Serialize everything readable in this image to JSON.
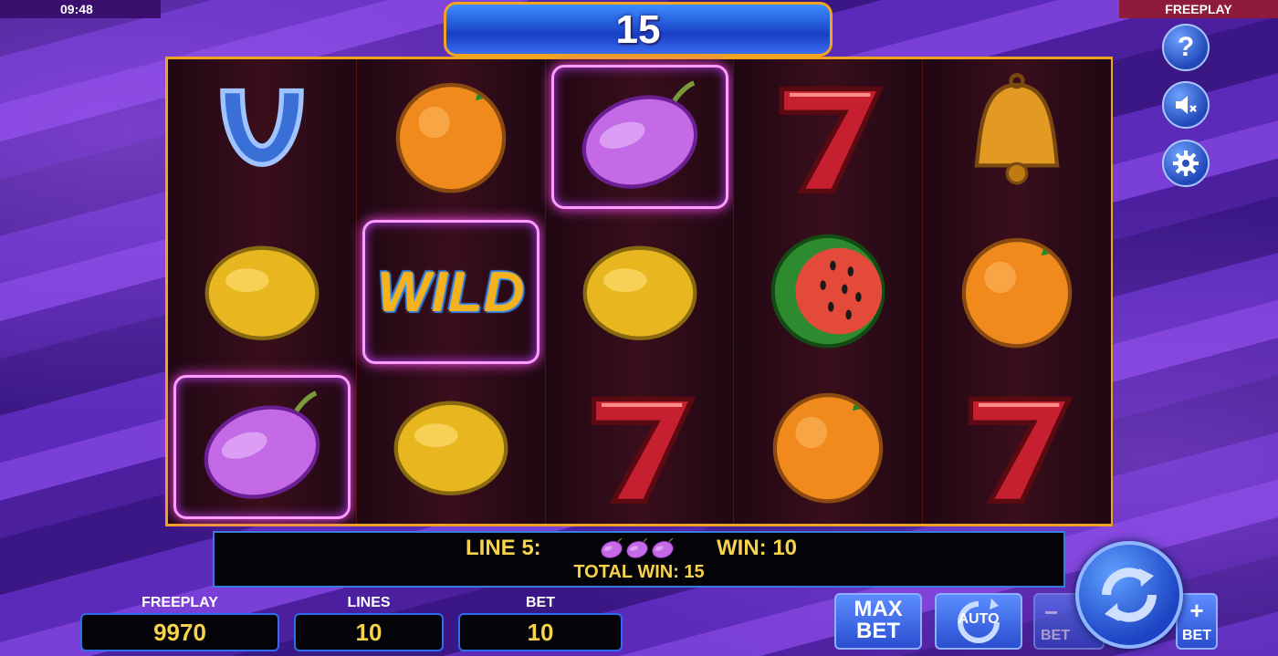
{
  "status": {
    "clock": "09:48",
    "mode": "FREEPLAY"
  },
  "win_counter": "15",
  "side_buttons": [
    {
      "icon": "help-icon",
      "glyph": "?"
    },
    {
      "icon": "sound-muted-icon"
    },
    {
      "icon": "settings-gear-icon"
    }
  ],
  "reels": [
    [
      "horseshoe",
      "lemon",
      "plum"
    ],
    [
      "orange",
      "wild",
      "lemon"
    ],
    [
      "plum",
      "lemon",
      "seven"
    ],
    [
      "seven",
      "watermelon",
      "orange"
    ],
    [
      "bell",
      "orange",
      "seven"
    ]
  ],
  "highlighted_cells": [
    [
      0,
      2
    ],
    [
      1,
      1
    ],
    [
      2,
      0
    ]
  ],
  "wild_text": "WILD",
  "message": {
    "line_label": "LINE 5:",
    "win_label": "WIN: 10",
    "total_label": "TOTAL WIN: 15",
    "line_symbol": "plum",
    "line_symbol_count": 3
  },
  "meters": {
    "freeplay": {
      "label": "FREEPLAY",
      "value": "9970"
    },
    "lines": {
      "label": "LINES",
      "value": "10"
    },
    "bet": {
      "label": "BET",
      "value": "10"
    }
  },
  "buttons": {
    "max_bet": [
      "MAX",
      "BET"
    ],
    "auto": "AUTO",
    "bet_minus": "BET",
    "bet_plus": "BET"
  },
  "colors": {
    "gold": "#f6d34a",
    "frame": "#f0a322",
    "accent_blue": "#2d6ef0"
  }
}
